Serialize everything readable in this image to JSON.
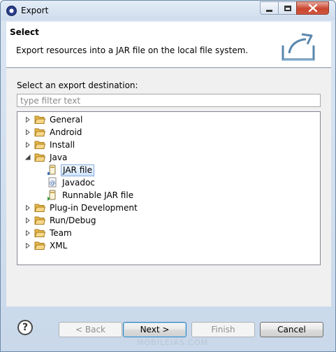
{
  "window": {
    "title": "Export",
    "icon": "eclipse-icon"
  },
  "header": {
    "title": "Select",
    "description": "Export resources into a JAR file on the local file system.",
    "banner_icon": "export-banner-icon"
  },
  "main": {
    "destination_label": "Select an export destination:",
    "filter": {
      "placeholder": "type filter text",
      "value": ""
    },
    "tree": {
      "general": "General",
      "android": "Android",
      "install": "Install",
      "java": "Java",
      "jar_file": "JAR file",
      "javadoc": "Javadoc",
      "runnable_jar": "Runnable JAR file",
      "plugin_dev": "Plug-in Development",
      "run_debug": "Run/Debug",
      "team": "Team",
      "xml": "XML",
      "selected": "JAR file"
    }
  },
  "footer": {
    "help": "?",
    "back": "< Back",
    "next": "Next >",
    "finish": "Finish",
    "cancel": "Cancel",
    "watermark": "MOBILEIAS.COM"
  },
  "colors": {
    "folder": "#e8b84a",
    "selection_border": "#84acdd",
    "close_button": "#c9452f"
  }
}
